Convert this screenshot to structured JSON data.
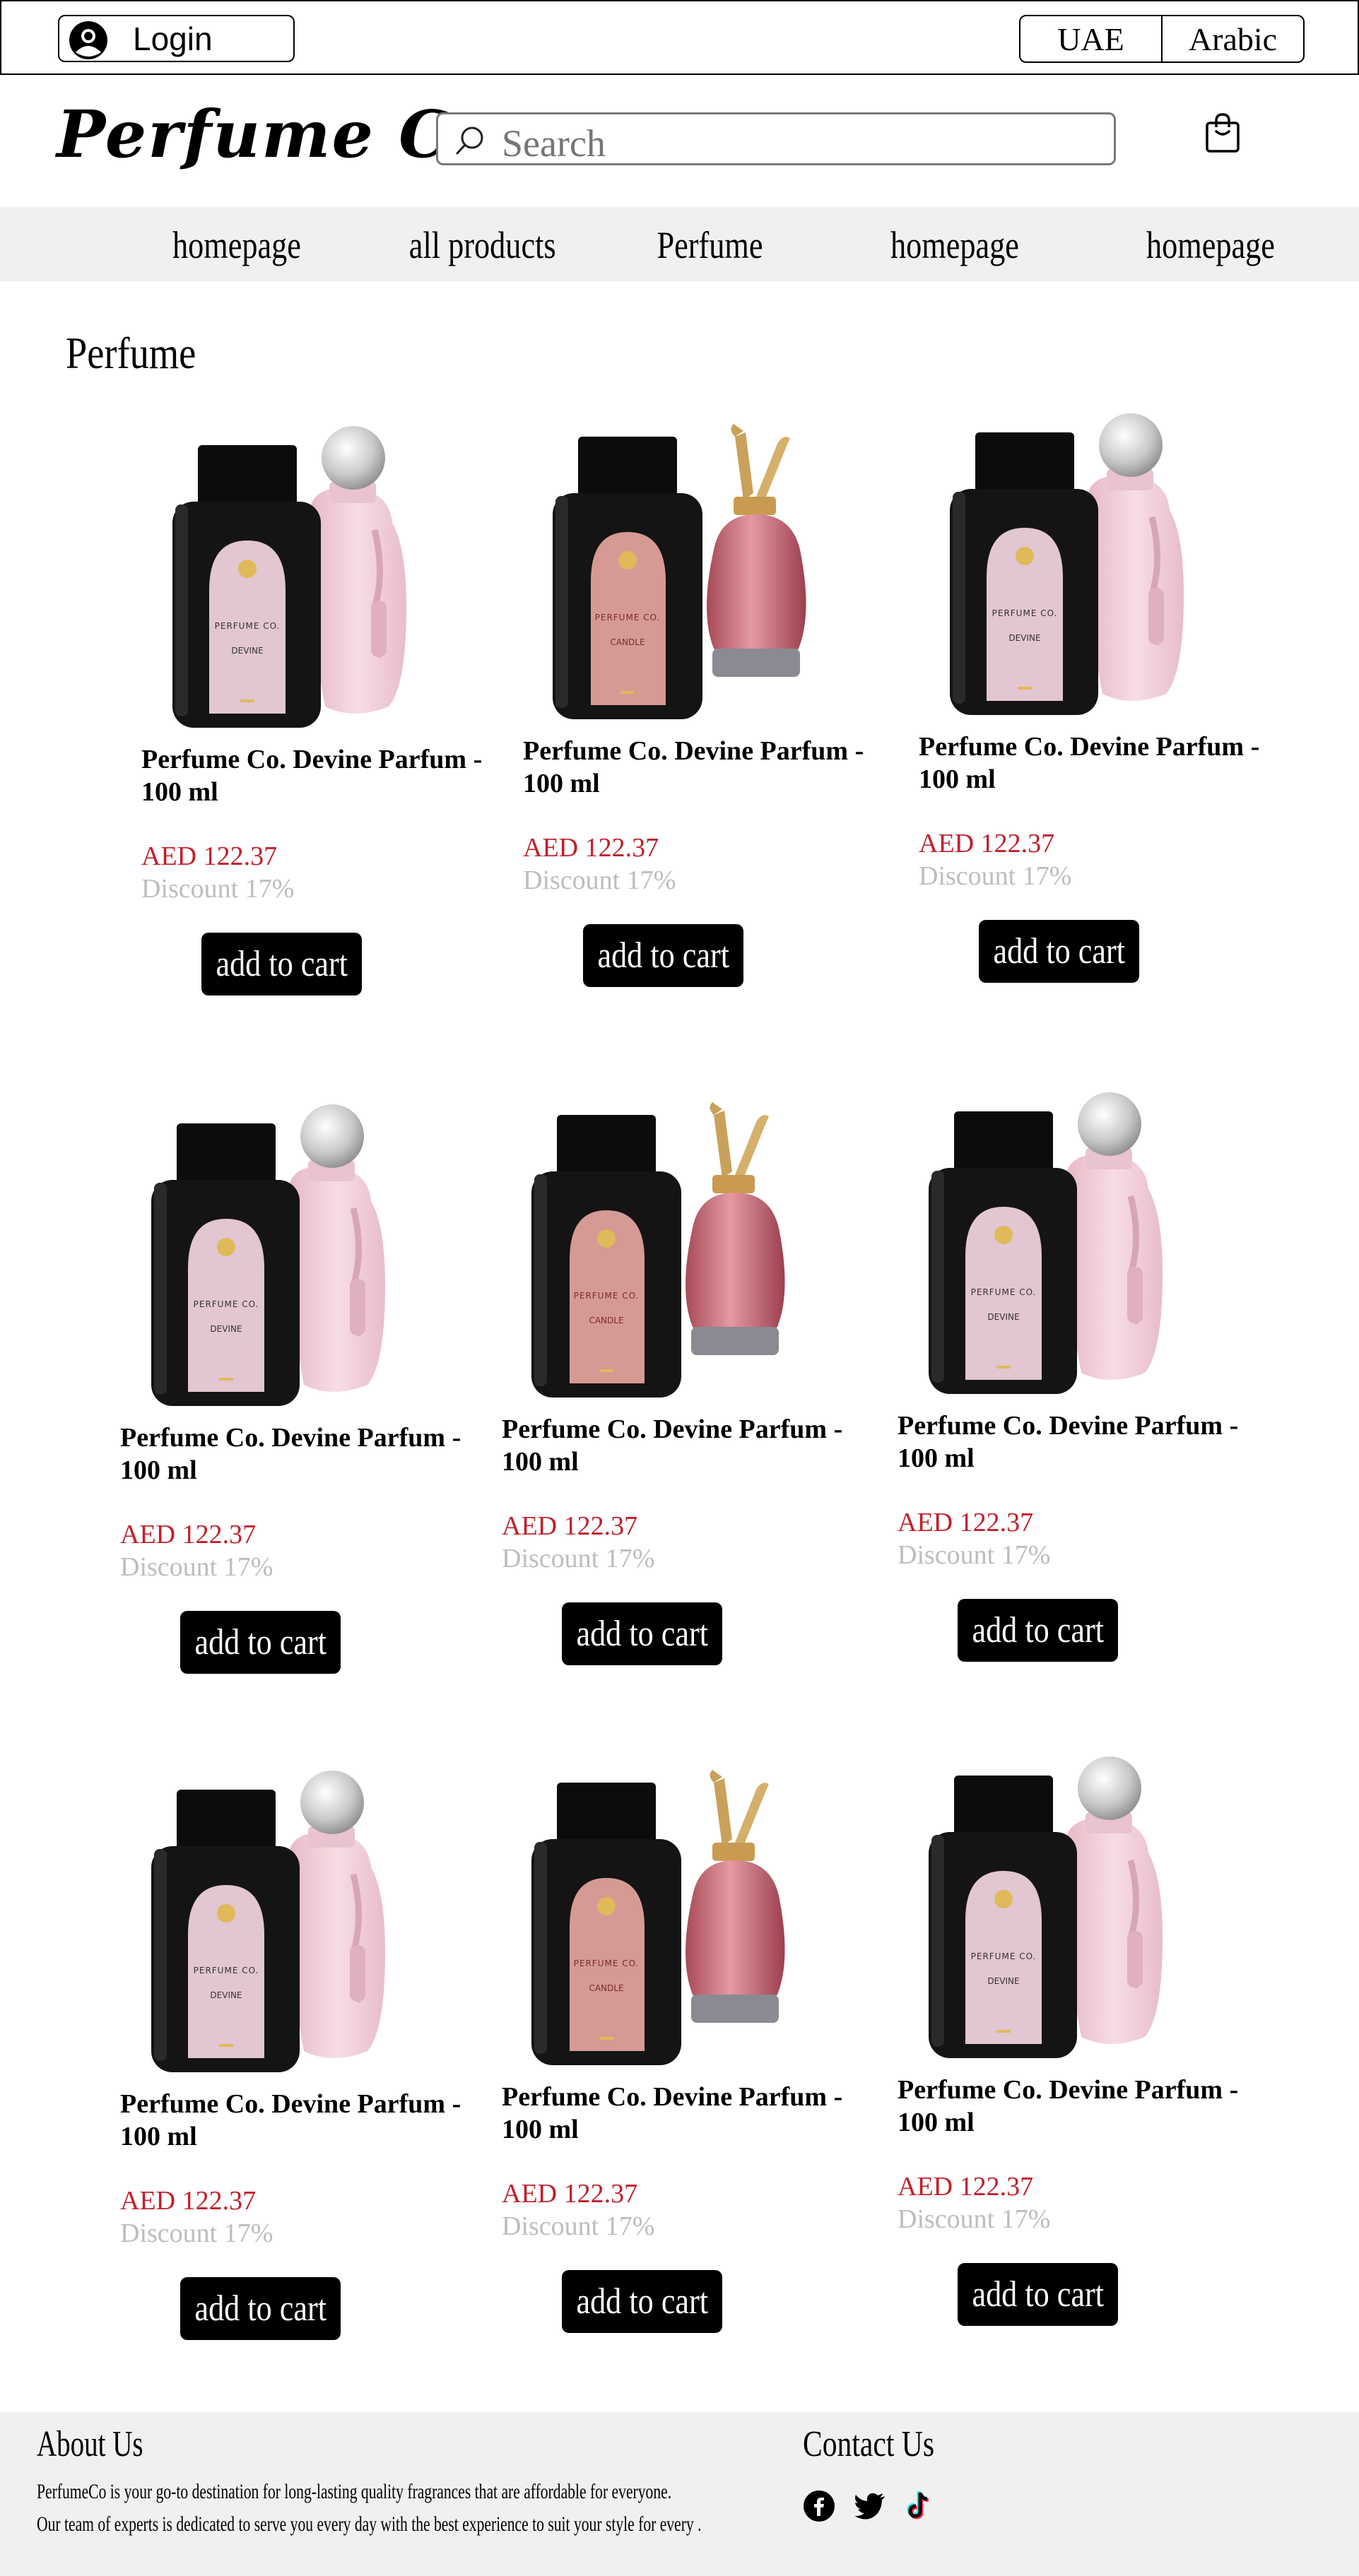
{
  "topbar": {
    "login_label": "Login",
    "languages": [
      "UAE",
      "Arabic"
    ]
  },
  "header": {
    "brand": "Perfume Co",
    "search_placeholder": "Search"
  },
  "nav": {
    "items": [
      "homepage",
      "all products",
      "Perfume",
      "homepage",
      "homepage"
    ]
  },
  "section_title": "Perfume",
  "products": [
    {
      "name": "Perfume Co. Devine Parfum - 100 ml",
      "price": "AED 122.37",
      "discount": "Discount 17%",
      "button": "add to cart",
      "image": "devine-bottle",
      "label_line1": "PERFUME CO.",
      "label_line2": "DEVINE"
    },
    {
      "name": "Perfume Co. Devine Parfum - 100 ml",
      "price": "AED 122.37",
      "discount": "Discount 17%",
      "button": "add to cart",
      "image": "candle-bottle",
      "label_line1": "PERFUME CO.",
      "label_line2": "CANDLE"
    },
    {
      "name": "Perfume Co. Devine Parfum - 100 ml",
      "price": "AED 122.37",
      "discount": "Discount 17%",
      "button": "add to cart",
      "image": "devine-bottle",
      "label_line1": "PERFUME CO.",
      "label_line2": "DEVINE"
    },
    {
      "name": "Perfume Co. Devine Parfum - 100 ml",
      "price": "AED 122.37",
      "discount": "Discount 17%",
      "button": "add to cart",
      "image": "devine-bottle",
      "label_line1": "PERFUME CO.",
      "label_line2": "DEVINE"
    },
    {
      "name": "Perfume Co. Devine Parfum - 100 ml",
      "price": "AED 122.37",
      "discount": "Discount 17%",
      "button": "add to cart",
      "image": "candle-bottle",
      "label_line1": "PERFUME CO.",
      "label_line2": "CANDLE"
    },
    {
      "name": "Perfume Co. Devine Parfum - 100 ml",
      "price": "AED 122.37",
      "discount": "Discount 17%",
      "button": "add to cart",
      "image": "devine-bottle",
      "label_line1": "PERFUME CO.",
      "label_line2": "DEVINE"
    },
    {
      "name": "Perfume Co. Devine Parfum - 100 ml",
      "price": "AED 122.37",
      "discount": "Discount 17%",
      "button": "add to cart",
      "image": "devine-bottle",
      "label_line1": "PERFUME CO.",
      "label_line2": "DEVINE"
    },
    {
      "name": "Perfume Co. Devine Parfum - 100 ml",
      "price": "AED 122.37",
      "discount": "Discount 17%",
      "button": "add to cart",
      "image": "candle-bottle",
      "label_line1": "PERFUME CO.",
      "label_line2": "CANDLE"
    },
    {
      "name": "Perfume Co. Devine Parfum - 100 ml",
      "price": "AED 122.37",
      "discount": "Discount 17%",
      "button": "add to cart",
      "image": "devine-bottle",
      "label_line1": "PERFUME CO.",
      "label_line2": "DEVINE"
    }
  ],
  "footer": {
    "about_title": "About Us",
    "about_line1": "PerfumeCo is your go-to destination for long-lasting quality fragrances that are affordable for everyone.",
    "about_line2": "Our team of experts is dedicated to serve you every day with the best experience to suit your style for every .",
    "contact_title": "Contact Us",
    "social": [
      "facebook-icon",
      "twitter-icon",
      "tiktok-icon"
    ]
  },
  "colors": {
    "price": "#c0202c",
    "discount": "#bdbdbd",
    "button_bg": "#000000",
    "nav_bg": "#f0f0f0",
    "bottle_pink": "#f0cdd6",
    "label_pink": "#e2c6d1",
    "label_rose": "#d69a95"
  }
}
